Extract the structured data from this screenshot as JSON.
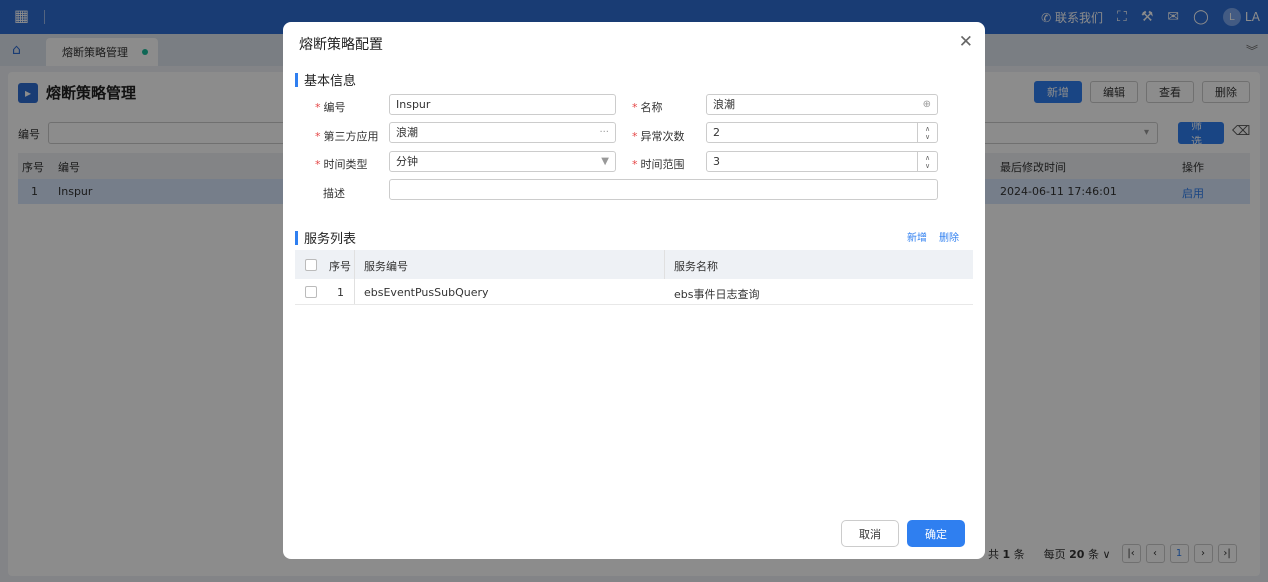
{
  "topbar": {
    "apps_icon": "grid-icon",
    "contact": "联系我们",
    "user_initial": "L",
    "user_name": "LA"
  },
  "tabs": {
    "active": "熔断策略管理"
  },
  "page": {
    "title": "熔断策略管理",
    "actions": [
      "新增",
      "编辑",
      "查看",
      "删除"
    ],
    "filter_label": "编号",
    "filter_button": "筛选",
    "grid_headers": {
      "seq": "序号",
      "code": "编号",
      "modified": "最后修改时间",
      "op": "操作"
    },
    "grid_row": {
      "seq": "1",
      "code": "Inspur",
      "modified": "2024-06-11 17:46:01",
      "op": "启用"
    }
  },
  "pager": {
    "total_prefix": "共",
    "total": "1",
    "total_suffix": "条",
    "per_page_prefix": "每页",
    "per_page": "20",
    "per_page_suffix": "条",
    "current": "1"
  },
  "dialog": {
    "title": "熔断策略配置",
    "basic_section": "基本信息",
    "fields": {
      "code_label": "编号",
      "code_value": "Inspur",
      "name_label": "名称",
      "name_value": "浪潮",
      "app_label": "第三方应用",
      "app_value": "浪潮",
      "count_label": "异常次数",
      "count_value": "2",
      "timetype_label": "时间类型",
      "timetype_value": "分钟",
      "range_label": "时间范围",
      "range_value": "3",
      "desc_label": "描述",
      "desc_value": ""
    },
    "service_section": "服务列表",
    "service_actions": {
      "add": "新增",
      "delete": "删除"
    },
    "service_headers": {
      "seq": "序号",
      "code": "服务编号",
      "name": "服务名称"
    },
    "service_rows": [
      {
        "seq": "1",
        "code": "ebsEventPusSubQuery",
        "name": "ebs事件日志查询"
      }
    ],
    "cancel": "取消",
    "confirm": "确定"
  }
}
